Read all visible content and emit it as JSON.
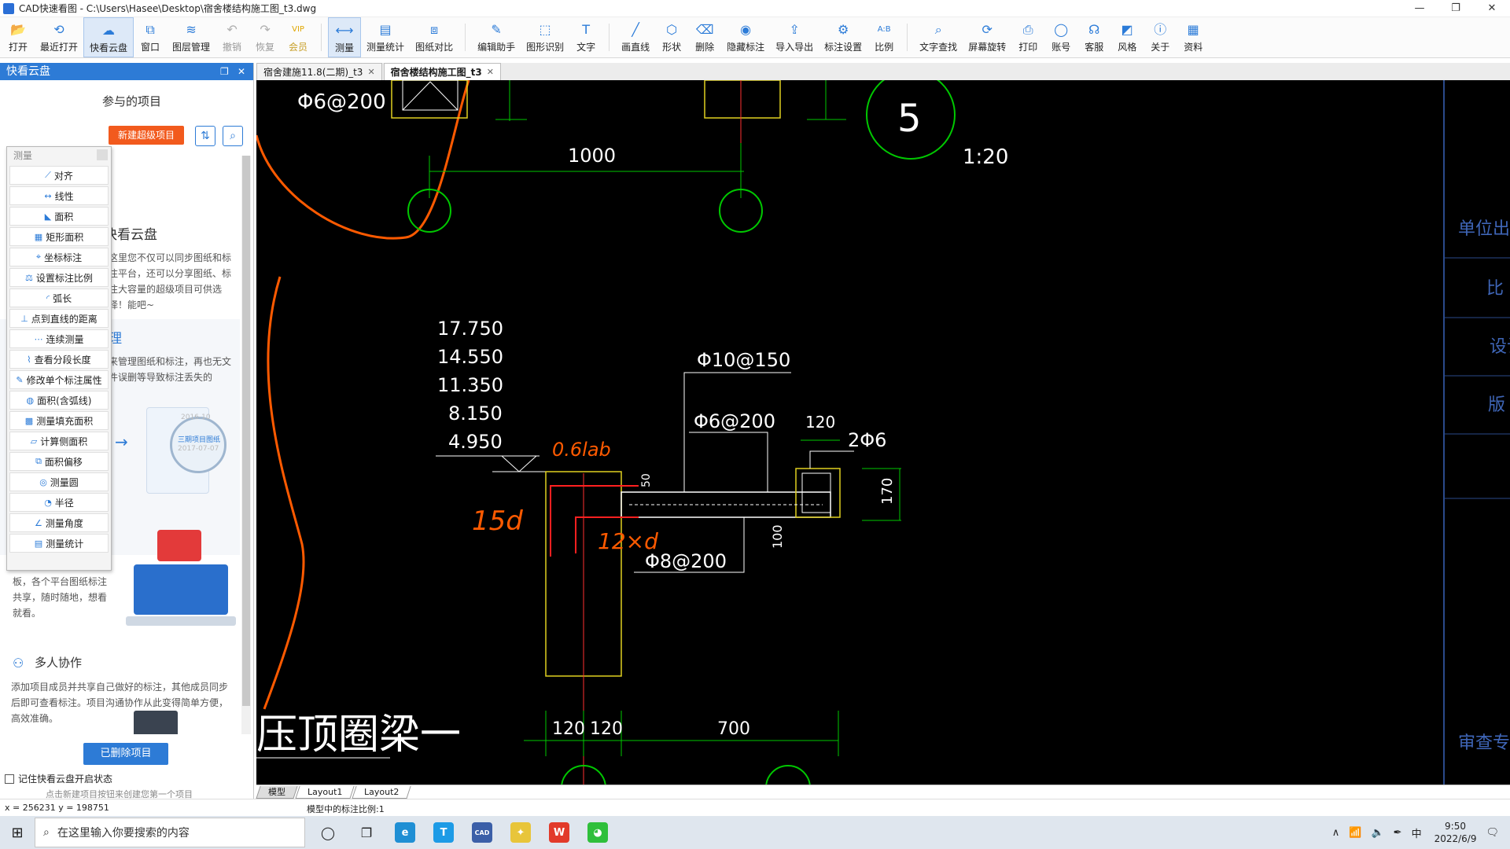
{
  "window": {
    "title": "CAD快速看图 - C:\\Users\\Hasee\\Desktop\\宿舍楼结构施工图_t3.dwg",
    "controls": [
      "—",
      "❐",
      "✕"
    ]
  },
  "toolbar": [
    {
      "id": "open",
      "label": "打开",
      "icon": "folder-icon",
      "glyph": "📂"
    },
    {
      "id": "recent",
      "label": "最近打开",
      "icon": "history-icon",
      "glyph": "⟲"
    },
    {
      "id": "cloud",
      "label": "快看云盘",
      "icon": "cloud-icon",
      "glyph": "☁",
      "active": true
    },
    {
      "id": "window",
      "label": "窗口",
      "icon": "window-icon",
      "glyph": "⧉"
    },
    {
      "id": "layers",
      "label": "图层管理",
      "icon": "layers-icon",
      "glyph": "≋"
    },
    {
      "id": "undo",
      "label": "撤销",
      "icon": "undo-icon",
      "glyph": "↶",
      "disabled": true
    },
    {
      "id": "redo",
      "label": "恢复",
      "icon": "redo-icon",
      "glyph": "↷",
      "disabled": true
    },
    {
      "id": "vip",
      "label": "会员",
      "icon": "vip-icon",
      "glyph": "VIP",
      "vip": true
    },
    {
      "id": "measure",
      "label": "测量",
      "icon": "ruler-icon",
      "glyph": "⟷",
      "active": true
    },
    {
      "id": "measure-stats",
      "label": "测量统计",
      "icon": "stats-icon",
      "glyph": "▤"
    },
    {
      "id": "compare",
      "label": "图纸对比",
      "icon": "compare-icon",
      "glyph": "⧈"
    },
    {
      "id": "edit-helper",
      "label": "编辑助手",
      "icon": "edit-icon",
      "glyph": "✎"
    },
    {
      "id": "shape-recog",
      "label": "图形识别",
      "icon": "shape-recognition-icon",
      "glyph": "⬚"
    },
    {
      "id": "text",
      "label": "文字",
      "icon": "text-icon",
      "glyph": "T"
    },
    {
      "id": "line",
      "label": "画直线",
      "icon": "line-icon",
      "glyph": "╱"
    },
    {
      "id": "shape",
      "label": "形状",
      "icon": "shape-icon",
      "glyph": "⬡"
    },
    {
      "id": "delete",
      "label": "删除",
      "icon": "eraser-icon",
      "glyph": "⌫"
    },
    {
      "id": "hide-mark",
      "label": "隐藏标注",
      "icon": "eye-icon",
      "glyph": "◉"
    },
    {
      "id": "import-export",
      "label": "导入导出",
      "icon": "export-icon",
      "glyph": "⇪"
    },
    {
      "id": "mark-settings",
      "label": "标注设置",
      "icon": "settings-icon",
      "glyph": "⚙"
    },
    {
      "id": "ratio",
      "label": "比例",
      "icon": "ratio-icon",
      "glyph": "A:B"
    },
    {
      "id": "text-search",
      "label": "文字查找",
      "icon": "search-icon",
      "glyph": "⌕"
    },
    {
      "id": "rotate-screen",
      "label": "屏幕旋转",
      "icon": "rotate-icon",
      "glyph": "⟳"
    },
    {
      "id": "print",
      "label": "打印",
      "icon": "printer-icon",
      "glyph": "⎙"
    },
    {
      "id": "account",
      "label": "账号",
      "icon": "user-icon",
      "glyph": "◯"
    },
    {
      "id": "support",
      "label": "客服",
      "icon": "headset-icon",
      "glyph": "☊"
    },
    {
      "id": "style",
      "label": "风格",
      "icon": "style-icon",
      "glyph": "◩"
    },
    {
      "id": "about",
      "label": "关于",
      "icon": "info-icon",
      "glyph": "ⓘ"
    },
    {
      "id": "resources",
      "label": "资料",
      "icon": "book-icon",
      "glyph": "▦"
    }
  ],
  "left_panel": {
    "header": "快看云盘",
    "header_controls": [
      "❐",
      "✕"
    ],
    "subtitle": "参与的项目",
    "new_button": "新建超级项目",
    "sync_icon": "⇅",
    "search_icon": "⌕",
    "intro_title": "快看云盘",
    "intro_text": "这里您不仅可以同步图纸和标注平台，还可以分享图纸、标注大容量的超级项目可供选择！能吧~",
    "sec2_title": "理",
    "sec2_text": "来管理图纸和标注，再也无文件误删等导致标注丢失的",
    "img1_date1": "2016-10",
    "img1_label": "三期项目图纸",
    "img1_date2": "2017-07-07",
    "sec3_text": "板，各个平台图纸标注共享，随时随地，想看就看。",
    "collab_title": "多人协作",
    "collab_text": "添加项目成员并共享自己做好的标注，其他成员同步后即可查看标注。项目沟通协作从此变得简单方便，高效准确。",
    "deleted_button": "已删除项目",
    "remember_label": "记住快看云盘开启状态",
    "hint": "点击新建项目按钮来创建您第一个项目"
  },
  "measure_menu": {
    "title": "测量",
    "items": [
      {
        "label": "对齐",
        "icon": "align-icon",
        "glyph": "⟋"
      },
      {
        "label": "线性",
        "icon": "linear-icon",
        "glyph": "↔"
      },
      {
        "label": "面积",
        "icon": "area-icon",
        "glyph": "◣"
      },
      {
        "label": "矩形面积",
        "icon": "rect-area-icon",
        "glyph": "▦"
      },
      {
        "label": "坐标标注",
        "icon": "coordinate-icon",
        "glyph": "⌖"
      },
      {
        "label": "设置标注比例",
        "icon": "scale-icon",
        "glyph": "⚖"
      },
      {
        "label": "弧长",
        "icon": "arc-icon",
        "glyph": "◜"
      },
      {
        "label": "点到直线的距离",
        "icon": "point-line-icon",
        "glyph": "⊥"
      },
      {
        "label": "连续测量",
        "icon": "continuous-icon",
        "glyph": "⋯"
      },
      {
        "label": "查看分段长度",
        "icon": "segment-icon",
        "glyph": "⌇"
      },
      {
        "label": "修改单个标注属性",
        "icon": "edit-mark-icon",
        "glyph": "✎"
      },
      {
        "label": "面积(含弧线)",
        "icon": "arc-area-icon",
        "glyph": "◍"
      },
      {
        "label": "测量填充面积",
        "icon": "fill-area-icon",
        "glyph": "▩"
      },
      {
        "label": "计算侧面积",
        "icon": "side-area-icon",
        "glyph": "▱"
      },
      {
        "label": "面积偏移",
        "icon": "offset-icon",
        "glyph": "⧉"
      },
      {
        "label": "测量圆",
        "icon": "circle-icon",
        "glyph": "◎"
      },
      {
        "label": "半径",
        "icon": "radius-icon",
        "glyph": "◔"
      },
      {
        "label": "测量角度",
        "icon": "angle-icon",
        "glyph": "∠"
      },
      {
        "label": "测量统计",
        "icon": "stats-icon",
        "glyph": "▤"
      }
    ]
  },
  "tabs": [
    {
      "label": "宿舍建施11.8(二期)_t3",
      "active": false
    },
    {
      "label": "宿舍楼结构施工图_t3",
      "active": true
    }
  ],
  "drawing": {
    "top_rebar": "Φ6@200",
    "dim_1000": "1000",
    "detail_number": "5",
    "scale": "1:20",
    "elevations": [
      "17.750",
      "14.550",
      "11.350",
      "8.150",
      "4.950"
    ],
    "rebar_top": "Φ10@150",
    "rebar_mid": "Φ6@200",
    "dim_120_top": "120",
    "rebar_2": "2Φ6",
    "dim_170": "170",
    "dim_50": "50",
    "dim_100": "100",
    "rebar_bottom": "Φ8@200",
    "dims_bottom": [
      "120",
      "120",
      "700"
    ],
    "caption": "压顶圈梁一",
    "handwritten_1": "0.6lab",
    "handwritten_2": "15d",
    "handwritten_3": "12×d",
    "title_block": [
      "单位出图",
      "比",
      "设计",
      "版",
      "审查专用"
    ]
  },
  "layout_tabs": [
    "模型",
    "Layout1",
    "Layout2"
  ],
  "status": {
    "coords": "x = 256231  y = 198751",
    "scale_text": "模型中的标注比例:1"
  },
  "taskbar": {
    "search_placeholder": "在这里输入你要搜索的内容",
    "time": "9:50",
    "date": "2022/6/9",
    "ime": "中",
    "apps": [
      {
        "name": "edge-icon",
        "color": "#1f8fd4",
        "glyph": "e"
      },
      {
        "name": "t-app-icon",
        "color": "#1d9be6",
        "glyph": "T"
      },
      {
        "name": "cad-app-icon",
        "color": "#3b5fa8",
        "glyph": "CAD"
      },
      {
        "name": "lightbulb-app-icon",
        "color": "#e8c53a",
        "glyph": "✦"
      },
      {
        "name": "wps-icon",
        "color": "#e23a2a",
        "glyph": "W"
      },
      {
        "name": "wechat-icon",
        "color": "#2fbf3b",
        "glyph": "◕"
      }
    ]
  },
  "colors": {
    "accent": "#2d7bd6",
    "orange_button": "#f25a1d",
    "canvas": "#000000",
    "green_lines": "#00c800",
    "yellow_lines": "#e0d020",
    "orange_markup": "#ff5a00"
  }
}
